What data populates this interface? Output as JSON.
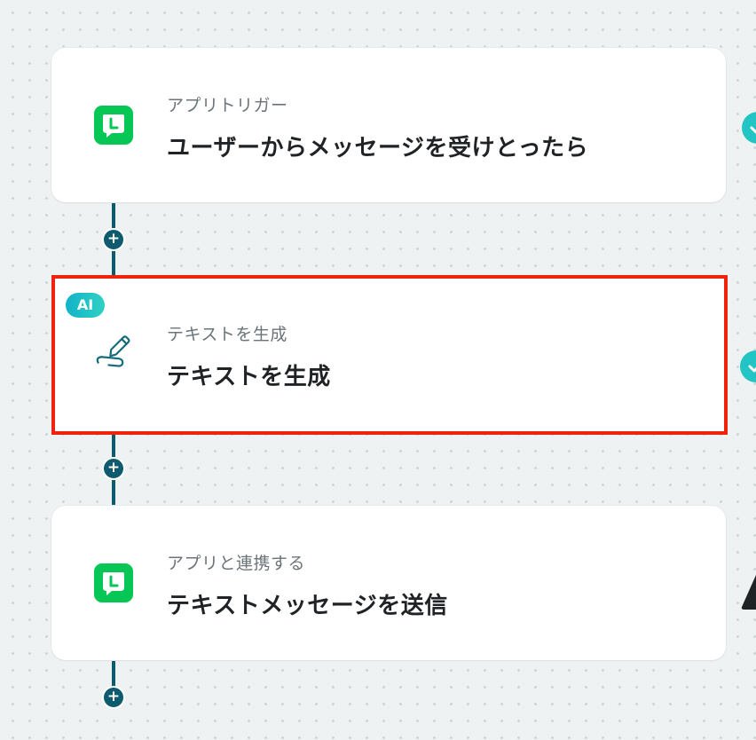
{
  "steps": [
    {
      "type_label": "アプリトリガー",
      "title": "ユーザーからメッセージを受けとったら",
      "icon": "line-app-icon",
      "status": "complete"
    },
    {
      "badge": "AI",
      "type_label": "テキストを生成",
      "title": "テキストを生成",
      "icon": "pen-icon",
      "status": "complete",
      "selected": true
    },
    {
      "type_label": "アプリと連携する",
      "title": "テキストメッセージを送信",
      "icon": "line-app-icon",
      "status": "warning"
    }
  ],
  "add_step_label": "+",
  "colors": {
    "connector": "#0e5a6e",
    "line_green": "#06c755",
    "selection_border": "#f0230f",
    "ai_badge": "#13b3c9",
    "check": "#22c4c4"
  }
}
